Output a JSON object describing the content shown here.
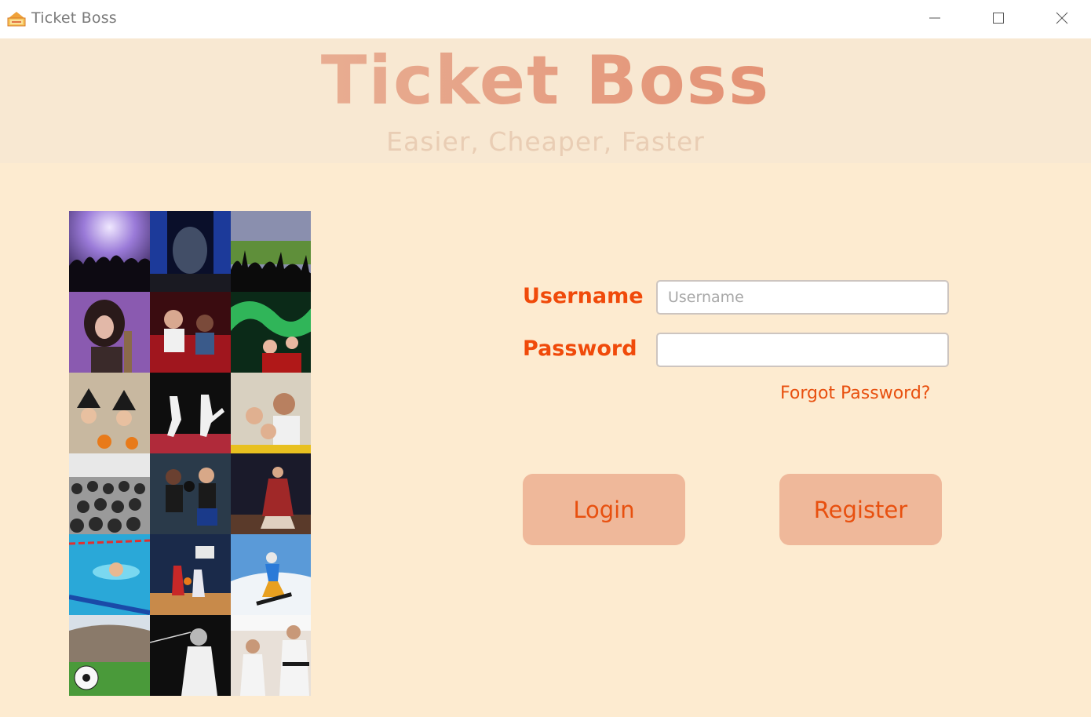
{
  "window": {
    "title": "Ticket Boss",
    "icon": "ticket-app-icon",
    "controls": {
      "minimize": "minimize-icon",
      "maximize": "maximize-icon",
      "close": "close-icon"
    }
  },
  "header": {
    "title": "Ticket Boss",
    "tagline": "Easier, Cheaper, Faster"
  },
  "gallery": {
    "photos": [
      "concert-crowd-photo",
      "theater-stage-photo",
      "stadium-fans-photo",
      "singer-photo",
      "cinema-audience-photo",
      "festival-light-photo",
      "halloween-kids-photo",
      "karate-sparring-photo",
      "family-selfie-photo",
      "auditorium-audience-photo",
      "boxing-match-photo",
      "stage-performance-photo",
      "swimming-photo",
      "basketball-game-photo",
      "snowboarding-photo",
      "soccer-stadium-photo",
      "fencing-photo",
      "taekwondo-photo"
    ]
  },
  "form": {
    "username_label": "Username",
    "username_placeholder": "Username",
    "username_value": "",
    "password_label": "Password",
    "password_value": "",
    "forgot_label": "Forgot Password?",
    "login_label": "Login",
    "register_label": "Register"
  },
  "colors": {
    "background": "#fdebd0",
    "accent": "#f04a0a",
    "button": "#efb89a"
  }
}
